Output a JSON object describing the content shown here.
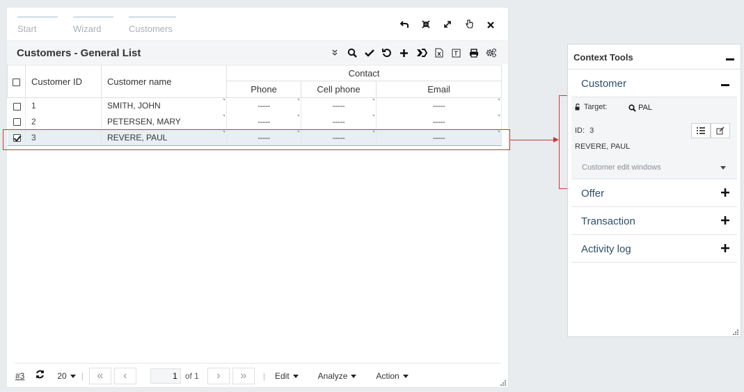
{
  "tabs": [
    "Start",
    "Wizard",
    "Customers"
  ],
  "window_controls": [
    "undo-icon",
    "close-fullscreen-icon",
    "expand-icon",
    "pin-icon",
    "close-icon"
  ],
  "title": "Customers - General List",
  "toolbar_icons": [
    "double-chevron-down-icon",
    "search-icon",
    "check-icon",
    "refresh-icon",
    "plus-icon",
    "merge-icon",
    "excel-icon",
    "export-icon",
    "print-icon",
    "settings-icon"
  ],
  "table": {
    "group_header": "Contact",
    "columns": {
      "id": "Customer ID",
      "name": "Customer name",
      "phone": "Phone",
      "cell": "Cell phone",
      "email": "Email"
    },
    "rows": [
      {
        "id": "1",
        "name": "SMITH, JOHN",
        "phone": "-----",
        "cell": "-----",
        "email": "-----",
        "checked": false
      },
      {
        "id": "2",
        "name": "PETERSEN, MARY",
        "phone": "-----",
        "cell": "-----",
        "email": "-----",
        "checked": false
      },
      {
        "id": "3",
        "name": "REVERE, PAUL",
        "phone": "-----",
        "cell": "-----",
        "email": "-----",
        "checked": true
      }
    ]
  },
  "pager": {
    "record_link": "#3",
    "page_size": "20",
    "page": "1",
    "of": "of 1",
    "menus": [
      "Edit",
      "Analyze",
      "Action"
    ]
  },
  "context": {
    "title": "Context Tools",
    "customer": {
      "title": "Customer",
      "target_label": "Target:",
      "target_value": "PAL",
      "id_label": "ID:",
      "id_value": "3",
      "name": "REVERE, PAUL",
      "dropdown": "Customer edit windows"
    },
    "sections": [
      "Offer",
      "Transaction",
      "Activity log"
    ]
  },
  "colors": {
    "accent": "#2e4d6b",
    "highlight": "#c9393b",
    "selected_row": "#e8eef4"
  }
}
